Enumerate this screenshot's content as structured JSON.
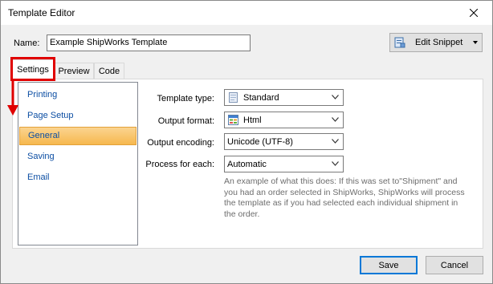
{
  "window": {
    "title": "Template Editor"
  },
  "name_field": {
    "label": "Name:",
    "value": "Example ShipWorks Template"
  },
  "snippet": {
    "label": "Edit Snippet"
  },
  "tabs": [
    {
      "label": "Settings",
      "active": true
    },
    {
      "label": "Preview",
      "active": false
    },
    {
      "label": "Code",
      "active": false
    }
  ],
  "sidebar": {
    "items": [
      {
        "label": "Printing"
      },
      {
        "label": "Page Setup"
      },
      {
        "label": "General",
        "selected": true
      },
      {
        "label": "Saving"
      },
      {
        "label": "Email"
      }
    ]
  },
  "form": {
    "template_type": {
      "label": "Template type:",
      "value": "Standard",
      "icon": "document-icon"
    },
    "output_format": {
      "label": "Output format:",
      "value": "Html",
      "icon": "html-grid-icon"
    },
    "output_encoding": {
      "label": "Output encoding:",
      "value": "Unicode (UTF-8)"
    },
    "process_for_each": {
      "label": "Process for each:",
      "value": "Automatic"
    },
    "help_text": "An example of what this does: If this was set to\"Shipment\" and you had an order selected in ShipWorks, ShipWorks will process the template as if you had selected each individual shipment in the order."
  },
  "buttons": {
    "save": "Save",
    "cancel": "Cancel"
  },
  "colors": {
    "annotation": "#e00000",
    "selection": "#f6b84e",
    "link": "#0c4ea3",
    "accent": "#0078d7"
  }
}
